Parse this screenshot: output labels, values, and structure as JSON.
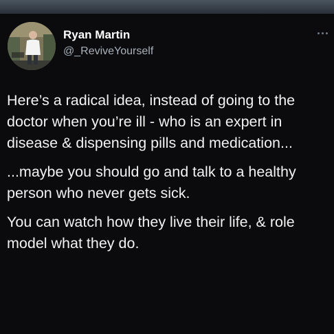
{
  "tweet": {
    "author_name": "Ryan Martin",
    "author_handle": "@_ReviveYourself",
    "paragraphs": [
      "Here’s a radical idea, instead of going to the doctor when you’re ill - who is an expert in disease & dispensing pills and medication...",
      "...maybe you should go and talk to a healthy person who never gets sick.",
      "You can watch how they live their life, & role model what they do."
    ]
  },
  "icons": {
    "avatar": "profile-photo",
    "menu": "more-options-icon"
  },
  "colors": {
    "background": "#0b0b0d",
    "text": "#ffffff",
    "handle": "#a9b2bb",
    "top_strip": "#3a434c"
  }
}
